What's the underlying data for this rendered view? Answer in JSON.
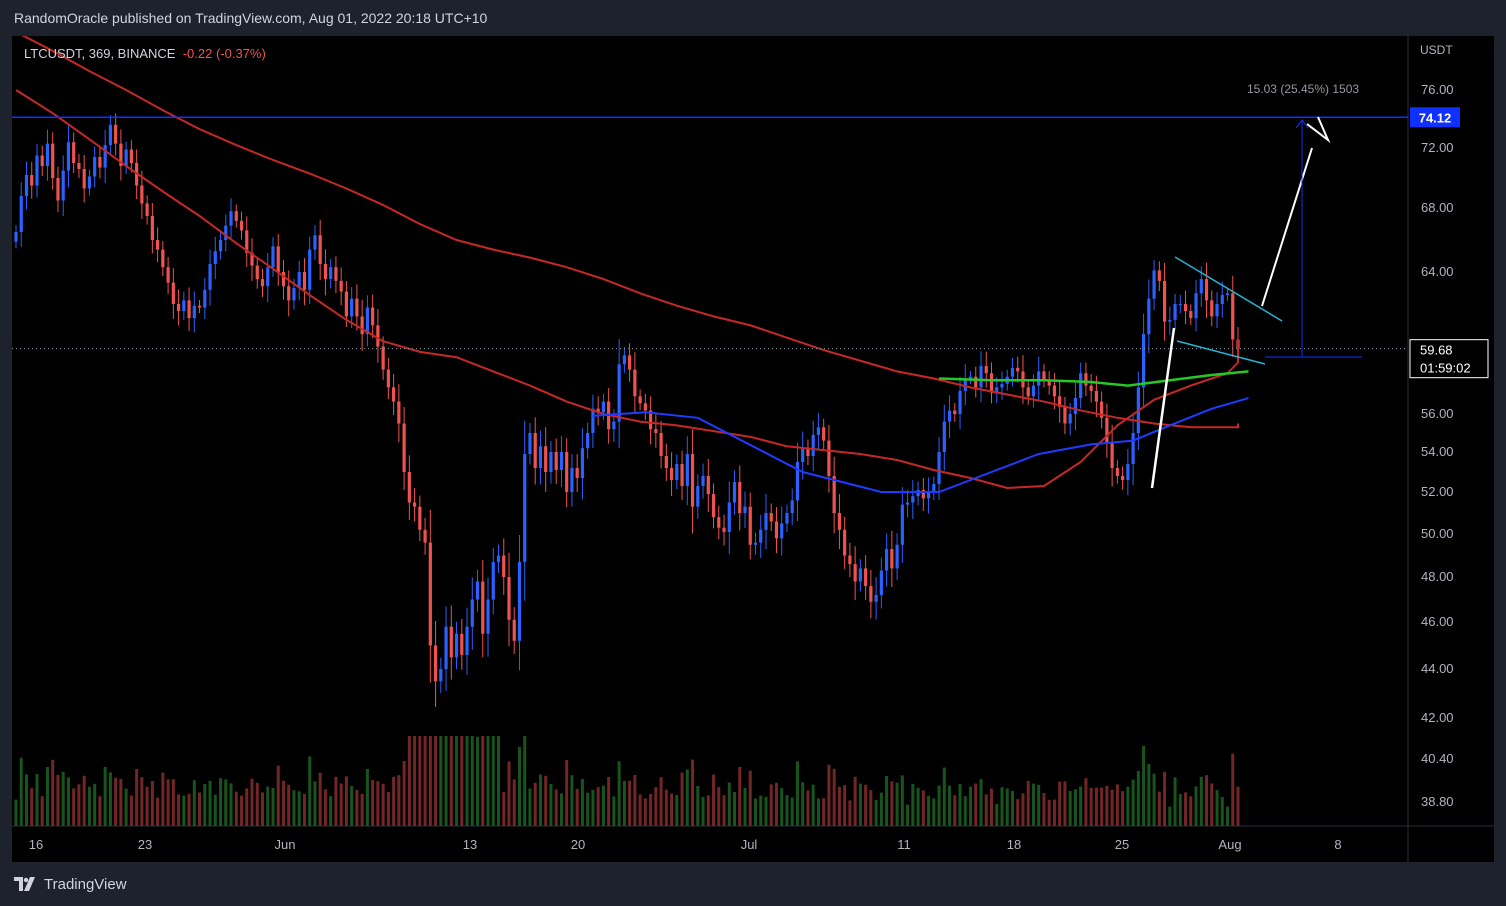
{
  "header": {
    "publish_line": "RandomOracle published on TradingView.com, Aug 01, 2022 20:18 UTC+10"
  },
  "legend": {
    "symbol_line": "LTCUSDT, 369, BINANCE",
    "change": "-0.22 (-0.37%)"
  },
  "footer": {
    "brand": "TradingView"
  },
  "chart_data": {
    "type": "candlestick",
    "currency_label": "USDT",
    "y_ticks": [
      "76.00",
      "72.00",
      "68.00",
      "64.00",
      "56.00",
      "54.00",
      "52.00",
      "50.00",
      "48.00",
      "46.00",
      "44.00",
      "42.00",
      "40.40",
      "38.80"
    ],
    "x_ticks": [
      "16",
      "23",
      "Jun",
      "13",
      "20",
      "Jul",
      "11",
      "18",
      "25",
      "Aug",
      "8"
    ],
    "resistance_level": 74.12,
    "last_price": "59.68",
    "countdown": "01:59:02",
    "measure_label": "15.03 (25.45%) 1503",
    "colors": {
      "up": "#2962ff",
      "down": "#ef5350",
      "ma_red": "#c62828",
      "ma_green": "#26c826",
      "ma_blue": "#1f3bff",
      "flag": "#22b5d4",
      "level": "#1030ff"
    },
    "closes": [
      66.5,
      68.8,
      70.2,
      69.5,
      71.5,
      70.8,
      72.3,
      70.0,
      68.5,
      70.5,
      72.4,
      71.0,
      70.6,
      69.3,
      70.1,
      71.4,
      70.7,
      72.2,
      73.6,
      72.3,
      70.8,
      71.9,
      71.0,
      69.5,
      68.3,
      67.5,
      66.0,
      65.4,
      64.3,
      63.4,
      62.2,
      61.8,
      62.4,
      61.4,
      62.1,
      62.0,
      63.0,
      64.5,
      65.3,
      66.0,
      66.9,
      67.8,
      67.2,
      66.6,
      65.2,
      64.4,
      63.6,
      63.2,
      64.3,
      65.6,
      64.0,
      63.2,
      62.4,
      63.1,
      64.0,
      63.0,
      65.4,
      66.3,
      64.5,
      63.6,
      64.3,
      63.5,
      62.9,
      61.5,
      62.5,
      61.5,
      60.5,
      62.0,
      61.0,
      59.8,
      58.5,
      57.5,
      56.7,
      55.5,
      53.0,
      51.5,
      51.3,
      50.2,
      49.6,
      45.0,
      43.5,
      44.0,
      45.8,
      44.5,
      45.5,
      44.6,
      45.8,
      47.0,
      47.8,
      45.5,
      47.0,
      48.7,
      49.0,
      48.0,
      46.1,
      45.2,
      48.7,
      53.9,
      55.0,
      53.2,
      54.3,
      53.0,
      54.0,
      53.1,
      54.0,
      52.0,
      53.2,
      52.7,
      54.2,
      55.0,
      56.3,
      56.1,
      56.7,
      55.2,
      55.6,
      58.8,
      59.3,
      58.5,
      57.0,
      56.6,
      56.2,
      55.2,
      55.0,
      53.8,
      53.2,
      52.6,
      53.4,
      52.3,
      53.9,
      51.3,
      52.3,
      52.8,
      51.9,
      50.8,
      50.3,
      50.1,
      51.5,
      52.5,
      51.0,
      51.3,
      49.5,
      49.6,
      50.2,
      51.0,
      50.6,
      49.8,
      50.5,
      51.0,
      51.6,
      53.5,
      54.2,
      53.8,
      54.9,
      55.3,
      54.6,
      52.8,
      51.0,
      50.2,
      49.0,
      48.6,
      47.8,
      48.4,
      47.6,
      46.9,
      47.2,
      48.3,
      49.3,
      48.4,
      49.5,
      51.4,
      51.5,
      51.8,
      52.1,
      51.7,
      52.0,
      52.4,
      54.0,
      55.6,
      56.2,
      56.0,
      57.3,
      58.0,
      58.1,
      57.5,
      58.7,
      58.3,
      57.2,
      57.5,
      57.7,
      58.1,
      58.6,
      58.4,
      57.5,
      57.0,
      57.6,
      58.4,
      57.9,
      57.6,
      57.0,
      56.4,
      55.5,
      56.0,
      56.9,
      58.3,
      57.6,
      57.3,
      56.7,
      55.8,
      54.5,
      53.2,
      52.8,
      52.6,
      53.4,
      55.0,
      57.5,
      60.5,
      62.5,
      64.1,
      63.5,
      61.2,
      61.3,
      62.2,
      62.2,
      61.8,
      61.4,
      62.8,
      63.6,
      62.4,
      61.5,
      62.2,
      62.7,
      62.8,
      60.2,
      59.68
    ],
    "series": [
      {
        "name": "",
        "values": [
          76.0,
          74.4,
          72.6,
          70.8,
          69.1,
          67.5,
          65.8,
          64.2,
          62.7,
          61.3,
          60.1,
          59.5,
          59.2,
          58.4,
          57.6,
          56.7,
          56.0,
          55.6,
          55.4,
          55.1,
          54.8,
          54.3,
          54.1,
          53.9,
          53.6,
          53.1,
          52.7,
          52.2,
          52.3,
          53.5,
          55.4,
          56.8,
          57.6,
          58.3,
          58.9,
          59.6,
          60.2
        ],
        "x_start": 0,
        "x_step": 7,
        "style": "ma_red_fast"
      },
      {
        "name": "",
        "values": [
          80.0,
          78.7,
          77.3,
          76.0,
          74.6,
          73.3,
          72.2,
          71.2,
          70.3,
          69.3,
          68.2,
          67.0,
          66.0,
          65.4,
          64.9,
          64.3,
          63.6,
          62.8,
          62.1,
          61.5,
          61.0,
          60.3,
          59.6,
          59.0,
          58.4,
          58.0,
          57.5,
          57.1,
          56.7,
          56.2,
          55.8,
          55.5,
          55.3,
          55.3,
          55.3,
          55.5
        ],
        "x_start": 0,
        "x_step": 7,
        "style": "ma_red_slow"
      }
    ]
  }
}
